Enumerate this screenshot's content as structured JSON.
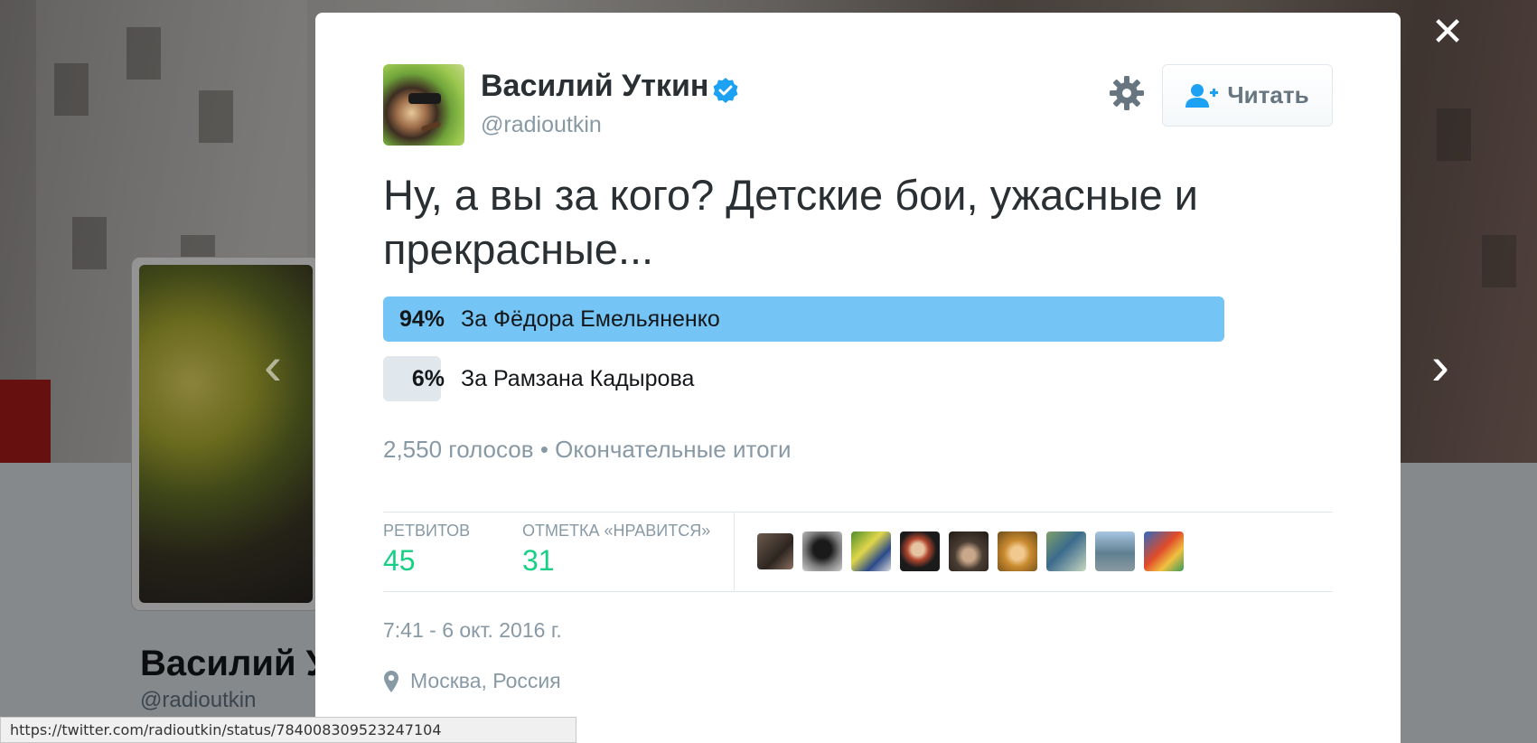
{
  "background": {
    "profile_name": "Василий Уткин",
    "profile_handle": "@radioutkin",
    "retweets_count": "45",
    "likes_count": "31"
  },
  "status_bar": {
    "url": "https://twitter.com/radioutkin/status/784008309523247104"
  },
  "tweet": {
    "author_name": "Василий Уткин",
    "author_handle": "@radioutkin",
    "verified": true,
    "follow_label": "Читать",
    "text": "Ну, а вы за кого? Детские бои, ужасные и прекрасные...",
    "poll": {
      "options": [
        {
          "percent_label": "94%",
          "percent": 94,
          "label": "За Фёдора Емельяненко",
          "winner": true
        },
        {
          "percent_label": "6%",
          "percent": 6,
          "label": "За Рамзана Кадырова",
          "winner": false
        }
      ],
      "votes": "2,550 голосов",
      "status": "Окончательные итоги",
      "separator": "•"
    },
    "stats": {
      "retweets_label": "РЕТВИТОВ",
      "retweets_value": "45",
      "likes_label": "ОТМЕТКА «НРАВИТСЯ»",
      "likes_value": "31"
    },
    "likers_count": 9,
    "timestamp": "7:41 - 6 окт. 2016 г.",
    "location": "Москва, Россия"
  },
  "colors": {
    "accent": "#1da1f2",
    "poll_winner": "#74c4f5",
    "poll_other": "#e1e8ed",
    "stat_value": "#19cf86",
    "muted_text": "#8899a6"
  },
  "icons": [
    "close-icon",
    "chevron-left-icon",
    "chevron-right-icon",
    "verified-badge-icon",
    "gear-icon",
    "follow-user-icon",
    "map-pin-icon",
    "heart-icon",
    "more-icon"
  ]
}
